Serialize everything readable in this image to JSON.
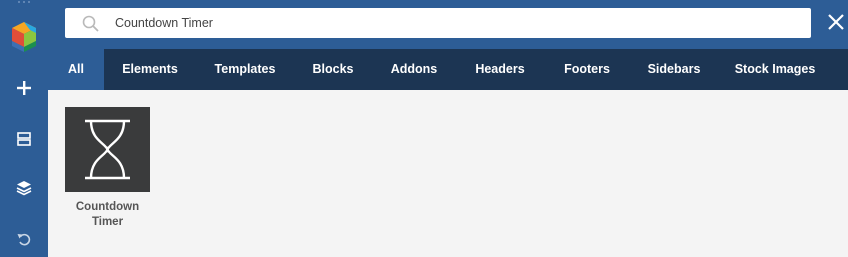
{
  "search": {
    "query": "Countdown Timer",
    "placeholder": ""
  },
  "icons": {
    "logo": "vc-logo-icon",
    "add": "plus-icon",
    "layout": "layout-icon",
    "layers": "layers-icon",
    "undo": "undo-icon",
    "search": "search-icon",
    "close": "close-icon",
    "tile": "hourglass-icon"
  },
  "tabs": [
    {
      "label": "All",
      "active": true
    },
    {
      "label": "Elements",
      "active": false
    },
    {
      "label": "Templates",
      "active": false
    },
    {
      "label": "Blocks",
      "active": false
    },
    {
      "label": "Addons",
      "active": false
    },
    {
      "label": "Headers",
      "active": false
    },
    {
      "label": "Footers",
      "active": false
    },
    {
      "label": "Sidebars",
      "active": false
    },
    {
      "label": "Stock Images",
      "active": false
    }
  ],
  "results": [
    {
      "title_line1": "Countdown",
      "title_line2": "Timer"
    }
  ],
  "colors": {
    "sidebar": "#2d5d96",
    "tabs_bar": "#1c3553",
    "active_tab": "#2d5d96",
    "tile": "#3a3b3c",
    "content_bg": "#f4f4f4"
  }
}
